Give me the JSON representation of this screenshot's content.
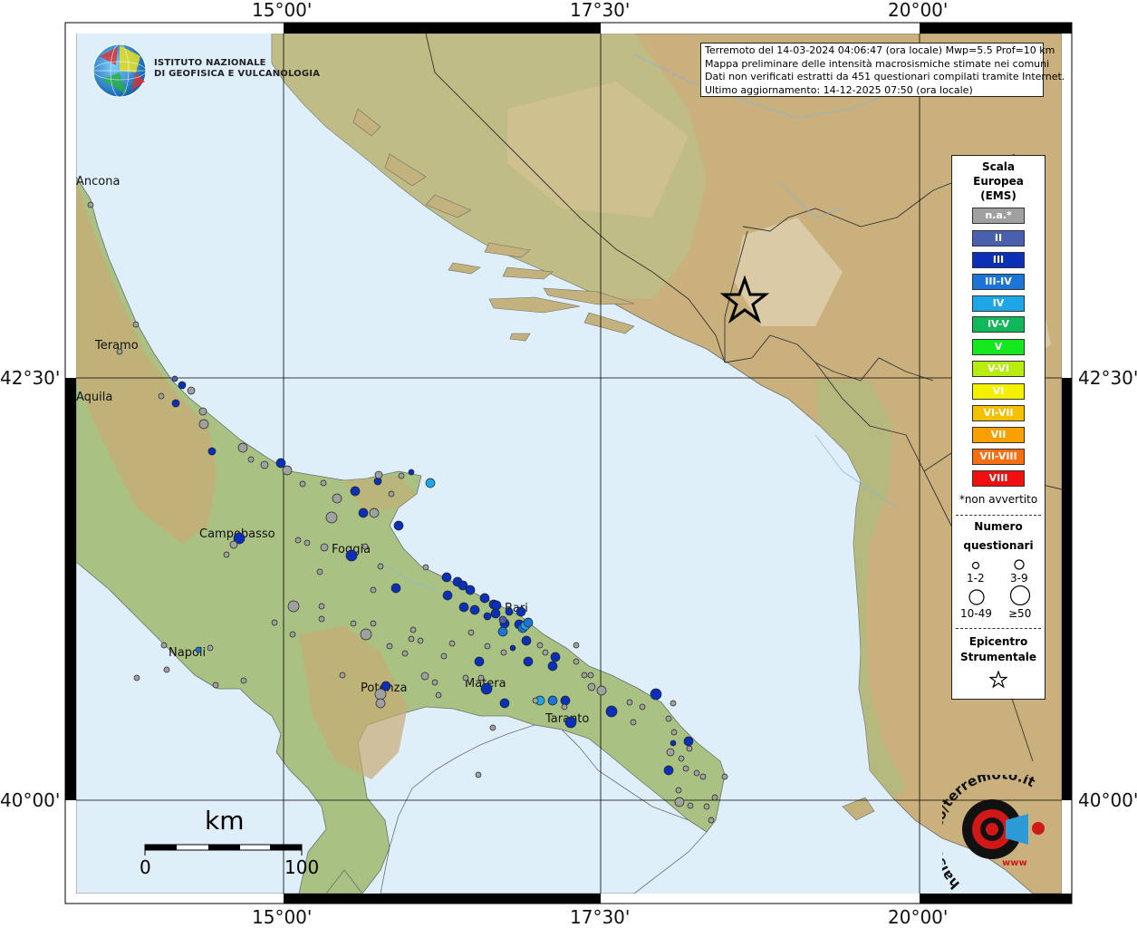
{
  "map": {
    "grid_longitudes": [
      "15°00'",
      "17°30'",
      "20°00'"
    ],
    "grid_latitudes": [
      "42°30'",
      "40°00'"
    ]
  },
  "institute": {
    "name_line1": "ISTITUTO NAZIONALE",
    "name_line2": "DI GEOFISICA E VULCANOLOGIA"
  },
  "info": {
    "line1": "Terremoto del 14-03-2024 04:06:47 (ora locale) Mwp=5.5 Prof=10 km",
    "line2": "Mappa preliminare delle intensità macrosismiche stimate nei comuni",
    "line3": "Dati non verificati estratti da 451 questionari compilati tramite Internet.",
    "line4": "Ultimo aggiornamento: 14-12-2025 07:50 (ora locale)"
  },
  "cities": [
    "Ancona",
    "Teramo",
    "Aquila",
    "Campobasso",
    "Foggia",
    "Bari",
    "Napoli",
    "Potenza",
    "Matera",
    "Taranto"
  ],
  "legend": {
    "title": [
      "Scala",
      "Europea",
      "(EMS)"
    ],
    "classes": [
      {
        "label": "n.a.*",
        "color": "#a0a0a0"
      },
      {
        "label": "II",
        "color": "#4a5fae"
      },
      {
        "label": "III",
        "color": "#0b30b8"
      },
      {
        "label": "III-IV",
        "color": "#1c74d6"
      },
      {
        "label": "IV",
        "color": "#1ea6e6"
      },
      {
        "label": "IV-V",
        "color": "#10b85a"
      },
      {
        "label": "V",
        "color": "#14e81e"
      },
      {
        "label": "V-VI",
        "color": "#b8ec10"
      },
      {
        "label": "VI",
        "color": "#f4f000"
      },
      {
        "label": "VI-VII",
        "color": "#f4c000"
      },
      {
        "label": "VII",
        "color": "#f8a000"
      },
      {
        "label": "VII-VIII",
        "color": "#f86e10"
      },
      {
        "label": "VIII",
        "color": "#f01010"
      }
    ],
    "note": "*non avvertito",
    "questionnaires_title": [
      "Numero",
      "questionari"
    ],
    "size_classes": [
      "1-2",
      "3-9",
      "10-49",
      "≥50"
    ],
    "epicenter_title": [
      "Epicentro",
      "Strumentale"
    ]
  },
  "scale_bar": {
    "unit": "km",
    "min_label": "0",
    "max_label": "100"
  },
  "watermark": {
    "text": "haisentito/terremoto.it",
    "url_text": "www"
  }
}
